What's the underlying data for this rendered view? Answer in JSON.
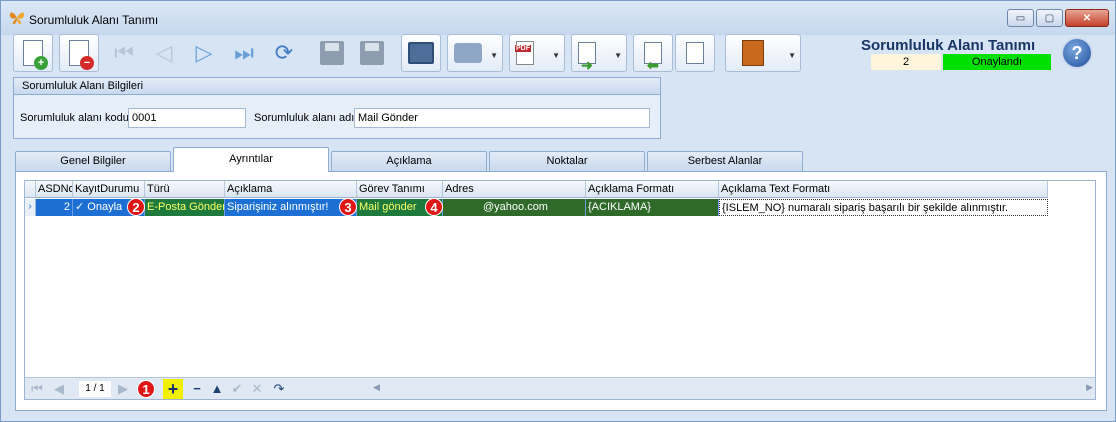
{
  "window": {
    "title": "Sorumluluk Alanı Tanımı",
    "controls": {
      "minimize": "▭",
      "maximize": "▢",
      "close": "✕"
    }
  },
  "toolbar": {
    "buttons": [
      {
        "icon": "new-document-icon"
      },
      {
        "icon": "delete-document-icon"
      },
      {
        "icon": "first-record-icon"
      },
      {
        "icon": "previous-record-icon"
      },
      {
        "icon": "next-record-icon"
      },
      {
        "icon": "last-record-icon"
      },
      {
        "icon": "refresh-icon"
      },
      {
        "icon": "save-icon"
      },
      {
        "icon": "save-close-icon"
      },
      {
        "icon": "preview-icon"
      },
      {
        "icon": "print-icon"
      },
      {
        "icon": "pdf-export-icon"
      },
      {
        "icon": "export-icon"
      },
      {
        "icon": "import-icon"
      },
      {
        "icon": "tools-icon"
      },
      {
        "icon": "exit-door-icon"
      }
    ],
    "pdf_badge": "PDF"
  },
  "header": {
    "title": "Sorumluluk Alanı Tanımı",
    "count": "2",
    "status": "Onaylandı",
    "status_color": "#00e000",
    "help_label": "?"
  },
  "info_group": {
    "title": "Sorumluluk Alanı Bilgileri",
    "code_label": "Sorumluluk alanı kodu",
    "code_value": "0001",
    "name_label": "Sorumluluk alanı adı",
    "name_value": "Mail Gönder"
  },
  "tabs": [
    {
      "label": "Genel Bilgiler",
      "active": false
    },
    {
      "label": "Ayrıntılar",
      "active": true
    },
    {
      "label": "Açıklama",
      "active": false
    },
    {
      "label": "Noktalar",
      "active": false
    },
    {
      "label": "Serbest Alanlar",
      "active": false
    }
  ],
  "grid": {
    "columns": [
      "ASDNo",
      "KayıtDurumu",
      "Türü",
      "Açıklama",
      "Görev Tanımı",
      "Adres",
      "Açıklama Formatı",
      "Açıklama Text Formatı"
    ],
    "rows": [
      {
        "asdno": "2",
        "status": "✓ Onayla",
        "type": "E-Posta Gönder",
        "description": "Siparişiniz alınmıştır!",
        "task": "Mail gönder",
        "address": "@yahoo.com",
        "desc_format": "{ACIKLAMA}",
        "text_format": "{ISLEM_NO} numaralı sipariş başarılı bir şekilde alınmıştır."
      }
    ],
    "row_indicator": "›"
  },
  "markers": [
    "1",
    "2",
    "3",
    "4"
  ],
  "navigator": {
    "position": "1 / 1",
    "add": "+",
    "remove": "−",
    "up": "▲",
    "confirm": "✔",
    "cancel": "✕",
    "redo": "↷"
  }
}
